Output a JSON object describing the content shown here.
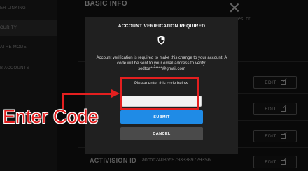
{
  "sidebar": {
    "items": [
      {
        "label": "ER LINKING"
      },
      {
        "label": "CURITY"
      },
      {
        "label": "ATRE MODE"
      },
      {
        "label": "B ACCOUNTS"
      }
    ]
  },
  "page": {
    "section_title": "BASIC INFO",
    "partial_text": "es, or",
    "edit_label": "EDIT",
    "bottom_field": {
      "label": "ACTIVISION ID",
      "value": "ancon240855979333897293S6"
    }
  },
  "modal": {
    "title": "ACCOUNT VERIFICATION REQUIRED",
    "message": "Account verification is required to make this change to your account. A code will be sent to your email address to verify:",
    "email": "sedtoa*******@gmail.com",
    "prompt": "Please enter this code below.",
    "code_placeholder": "",
    "submit_label": "SUBMIT",
    "cancel_label": "CANCEL",
    "shield_icon": "shield-icon"
  },
  "annotation": {
    "callout": "Enter Code",
    "color": "#e41f1f"
  },
  "colors": {
    "submit": "#1f8be6",
    "cancel": "#4a4a4a",
    "modal_bg": "#202020"
  }
}
